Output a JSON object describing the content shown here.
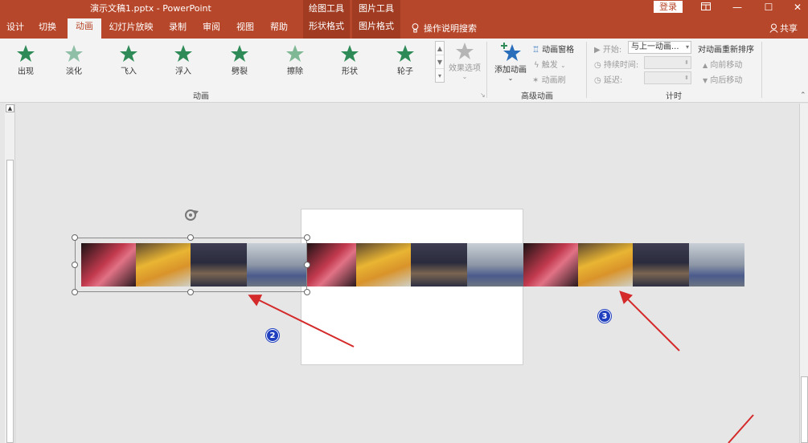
{
  "titlebar": {
    "title": "演示文稿1.pptx  -  PowerPoint",
    "ctx_drawing": "绘图工具",
    "ctx_picture": "图片工具",
    "login": "登录",
    "ribbon_display_icon": "ribbon-display-icon",
    "minimize_glyph": "—",
    "restore_glyph": "☐",
    "close_glyph": "✕"
  },
  "tabs": [
    {
      "label": "设计"
    },
    {
      "label": "切换"
    },
    {
      "label": "动画"
    },
    {
      "label": "幻灯片放映"
    },
    {
      "label": "录制"
    },
    {
      "label": "审阅"
    },
    {
      "label": "视图"
    },
    {
      "label": "帮助"
    },
    {
      "label": "形状格式"
    },
    {
      "label": "图片格式"
    }
  ],
  "search": {
    "label": "操作说明搜索"
  },
  "share": {
    "label": "共享"
  },
  "ribbon": {
    "gallery": [
      {
        "label": "出现",
        "color": "#2e8b57"
      },
      {
        "label": "淡化",
        "color": "#8fbfa6"
      },
      {
        "label": "飞入",
        "color": "#2e8b57"
      },
      {
        "label": "浮入",
        "color": "#2e8b57"
      },
      {
        "label": "劈裂",
        "color": "#2e8b57"
      },
      {
        "label": "擦除",
        "color": "#7fb895"
      },
      {
        "label": "形状",
        "color": "#2e8b57"
      },
      {
        "label": "轮子",
        "color": "#2e8b57"
      }
    ],
    "effect_options": "效果选项",
    "group_animation": "动画",
    "add_animation": "添加动画",
    "animation_pane": "动画窗格",
    "trigger": "触发",
    "animation_painter": "动画刷",
    "group_advanced": "高级动画",
    "start_label": "开始:",
    "start_value": "与上一动画...",
    "duration_label": "持续时间:",
    "delay_label": "延迟:",
    "group_timing": "计时",
    "reorder_title": "对动画重新排序",
    "move_earlier": "向前移动",
    "move_later": "向后移动"
  },
  "badges": {
    "two": "2",
    "three": "3"
  },
  "colors": {
    "accent": "#b7472a",
    "badge": "#1f3fbf",
    "arrow": "#d42a2a"
  }
}
